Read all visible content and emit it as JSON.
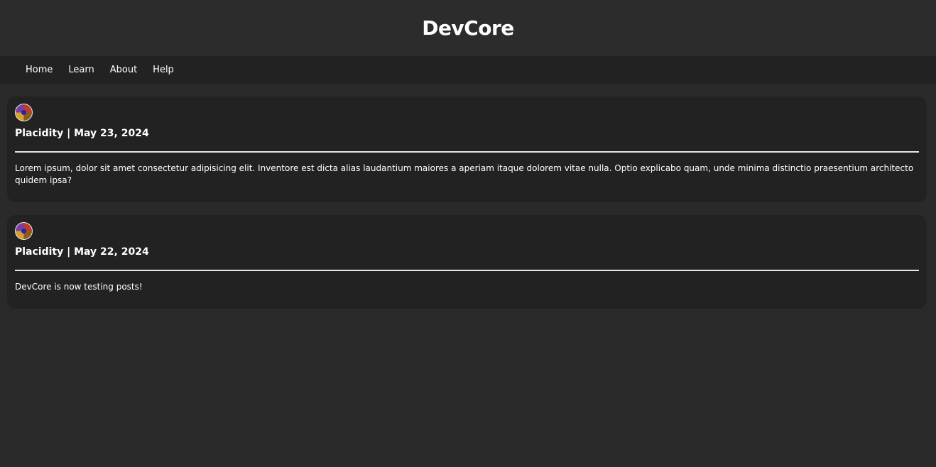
{
  "header": {
    "title": "DevCore"
  },
  "nav": {
    "items": [
      {
        "label": "Home"
      },
      {
        "label": "Learn"
      },
      {
        "label": "About"
      },
      {
        "label": "Help"
      }
    ]
  },
  "posts": [
    {
      "meta": "Placidity | May 23, 2024",
      "body": "Lorem ipsum, dolor sit amet consectetur adipisicing elit. Inventore est dicta alias laudantium maiores a aperiam itaque dolorem vitae nulla. Optio explicabo quam, unde minima distinctio praesentium architecto quidem ipsa?"
    },
    {
      "meta": "Placidity | May 22, 2024",
      "body": "DevCore is now testing posts!"
    }
  ],
  "colors": {
    "page_background": "#2a2a2a",
    "header_background": "#2c2c2c",
    "nav_background": "#222222",
    "card_background": "#222222",
    "text": "#ffffff",
    "divider": "#e6e6e6"
  },
  "icons": {
    "avatar": "user-avatar-icon"
  }
}
